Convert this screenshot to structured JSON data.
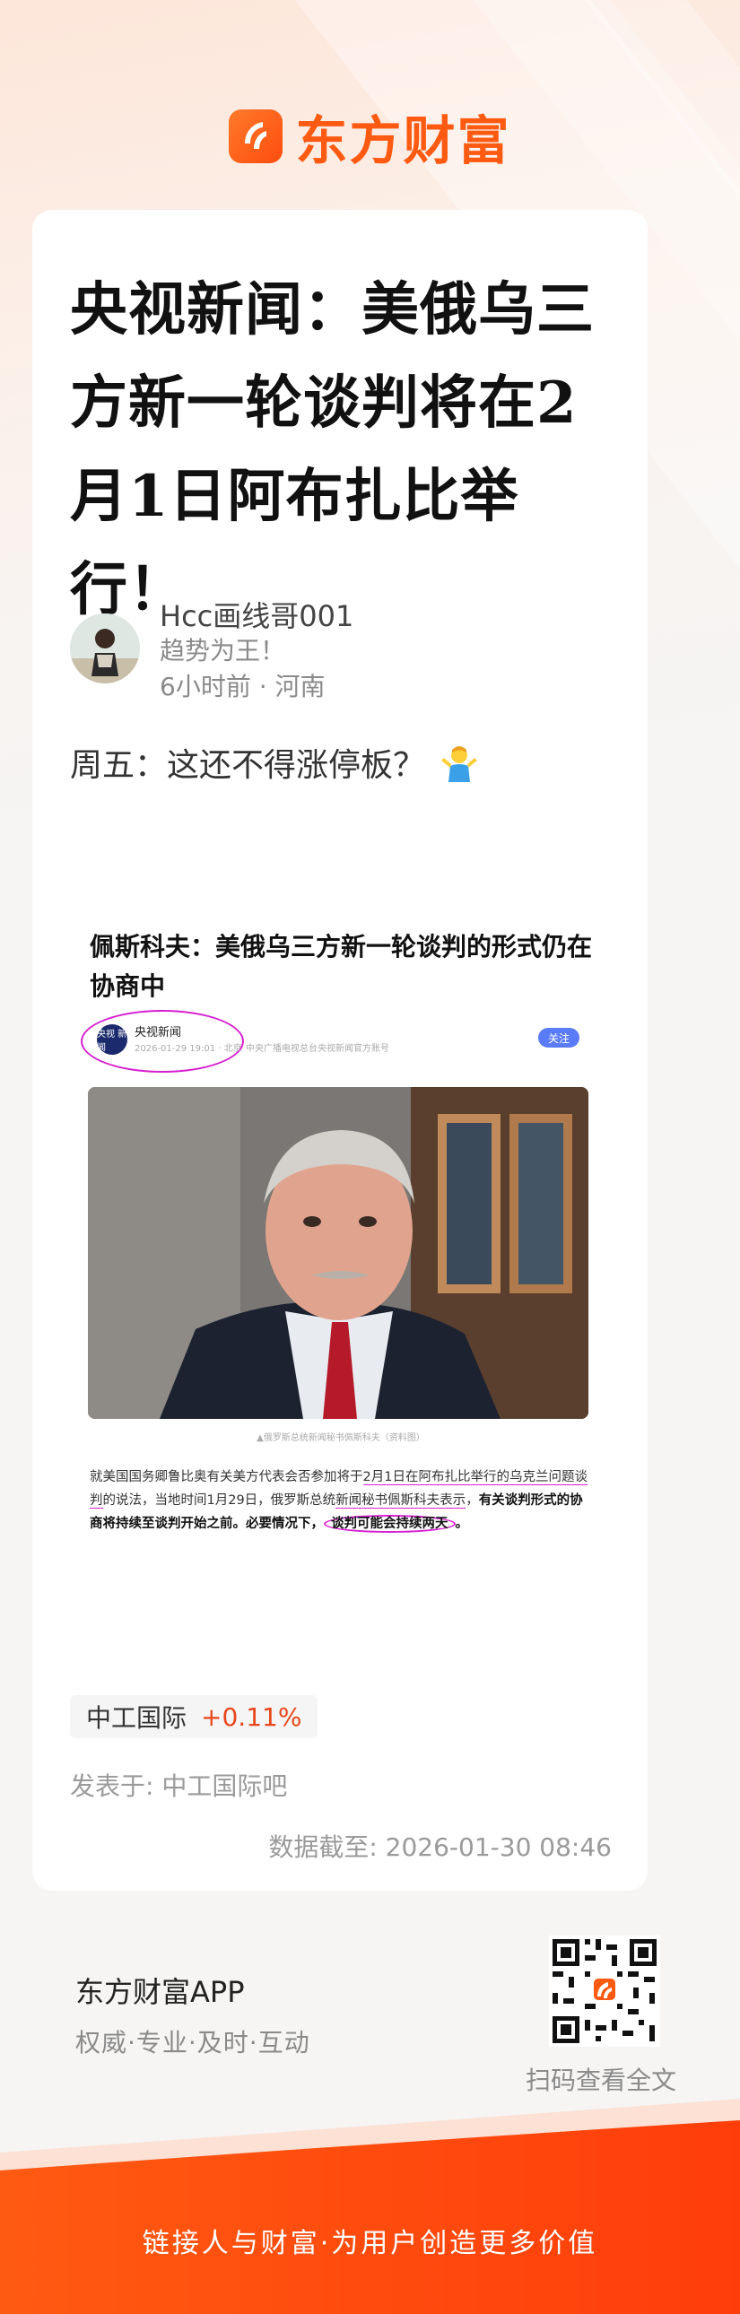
{
  "brand": {
    "name": "东方财富",
    "accent": "#ff5a12"
  },
  "article": {
    "title": "央视新闻：美俄乌三方新一轮谈判将在2月1日阿布扎比举行！",
    "author": {
      "name": "Hcc画线哥001",
      "motto": "趋势为王！",
      "meta": "6小时前 · 河南"
    },
    "text": "周五：这还不得涨停板？",
    "emoji": "shrug-person-icon"
  },
  "embed": {
    "title": "佩斯科夫：美俄乌三方新一轮谈判的形式仍在协商中",
    "source_logo": "央视 新闻",
    "source_name": "央视新闻",
    "source_time": "2026-01-29 19:01 · 北京",
    "source_desc": "中央广播电视总台央视新闻官方账号",
    "follow_label": "关注",
    "caption": "▲俄罗斯总统新闻秘书佩斯科夫（资料图）",
    "body": {
      "p1": "就美国国务卿鲁比奥有关美方代表会否参加将于",
      "p1_u": "2月1日在阿布扎比举行的乌克兰问题谈判",
      "p2": "的说法，当地时间1月29日，俄罗斯总统",
      "p2_u": "新闻秘书佩斯科夫表示",
      "p3": "，",
      "p3_b": "有关谈判形式的协商将持续至谈判开始之前。必要情况下，",
      "p3_c": "谈判可能会持续两天",
      "p3_end": "。"
    }
  },
  "stock": {
    "name": "中工国际",
    "change": "+0.11%",
    "change_color": "#e8471b"
  },
  "posted_in": "发表于: 中工国际吧",
  "data_time": "数据截至: 2026-01-30 08:46",
  "footer": {
    "app_name": "东方财富APP",
    "app_slogan": "权威·专业·及时·互动",
    "qr_label": "扫码查看全文",
    "bottom_slogan": "链接人与财富·为用户创造更多价值"
  }
}
